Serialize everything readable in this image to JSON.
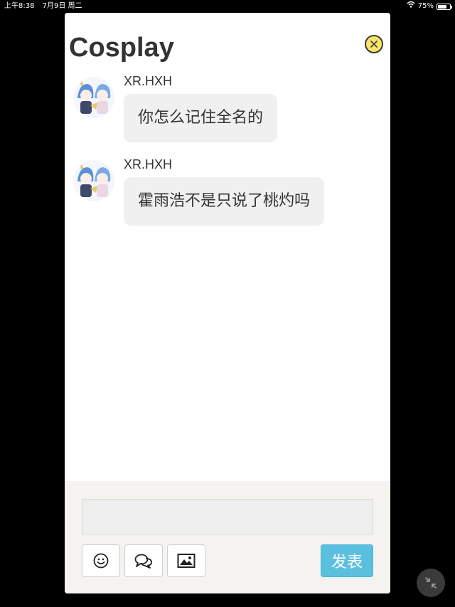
{
  "status_bar": {
    "time": "上午8:38",
    "date": "7月9日 周二",
    "battery_percent": "75%",
    "battery_level": 0.75
  },
  "chat": {
    "title": "Cosplay",
    "close_icon": "close-icon",
    "messages": [
      {
        "username": "XR.HXH",
        "text": "你怎么记住全名的"
      },
      {
        "username": "XR.HXH",
        "text": "霍雨浩不是只说了桃灼吗"
      }
    ]
  },
  "composer": {
    "input_value": "",
    "tools": [
      "emoji-icon",
      "comment-icon",
      "image-icon"
    ],
    "send_label": "发表",
    "accent_color": "#5bc0de"
  },
  "floating_button": {
    "icon": "minimize-icon"
  }
}
